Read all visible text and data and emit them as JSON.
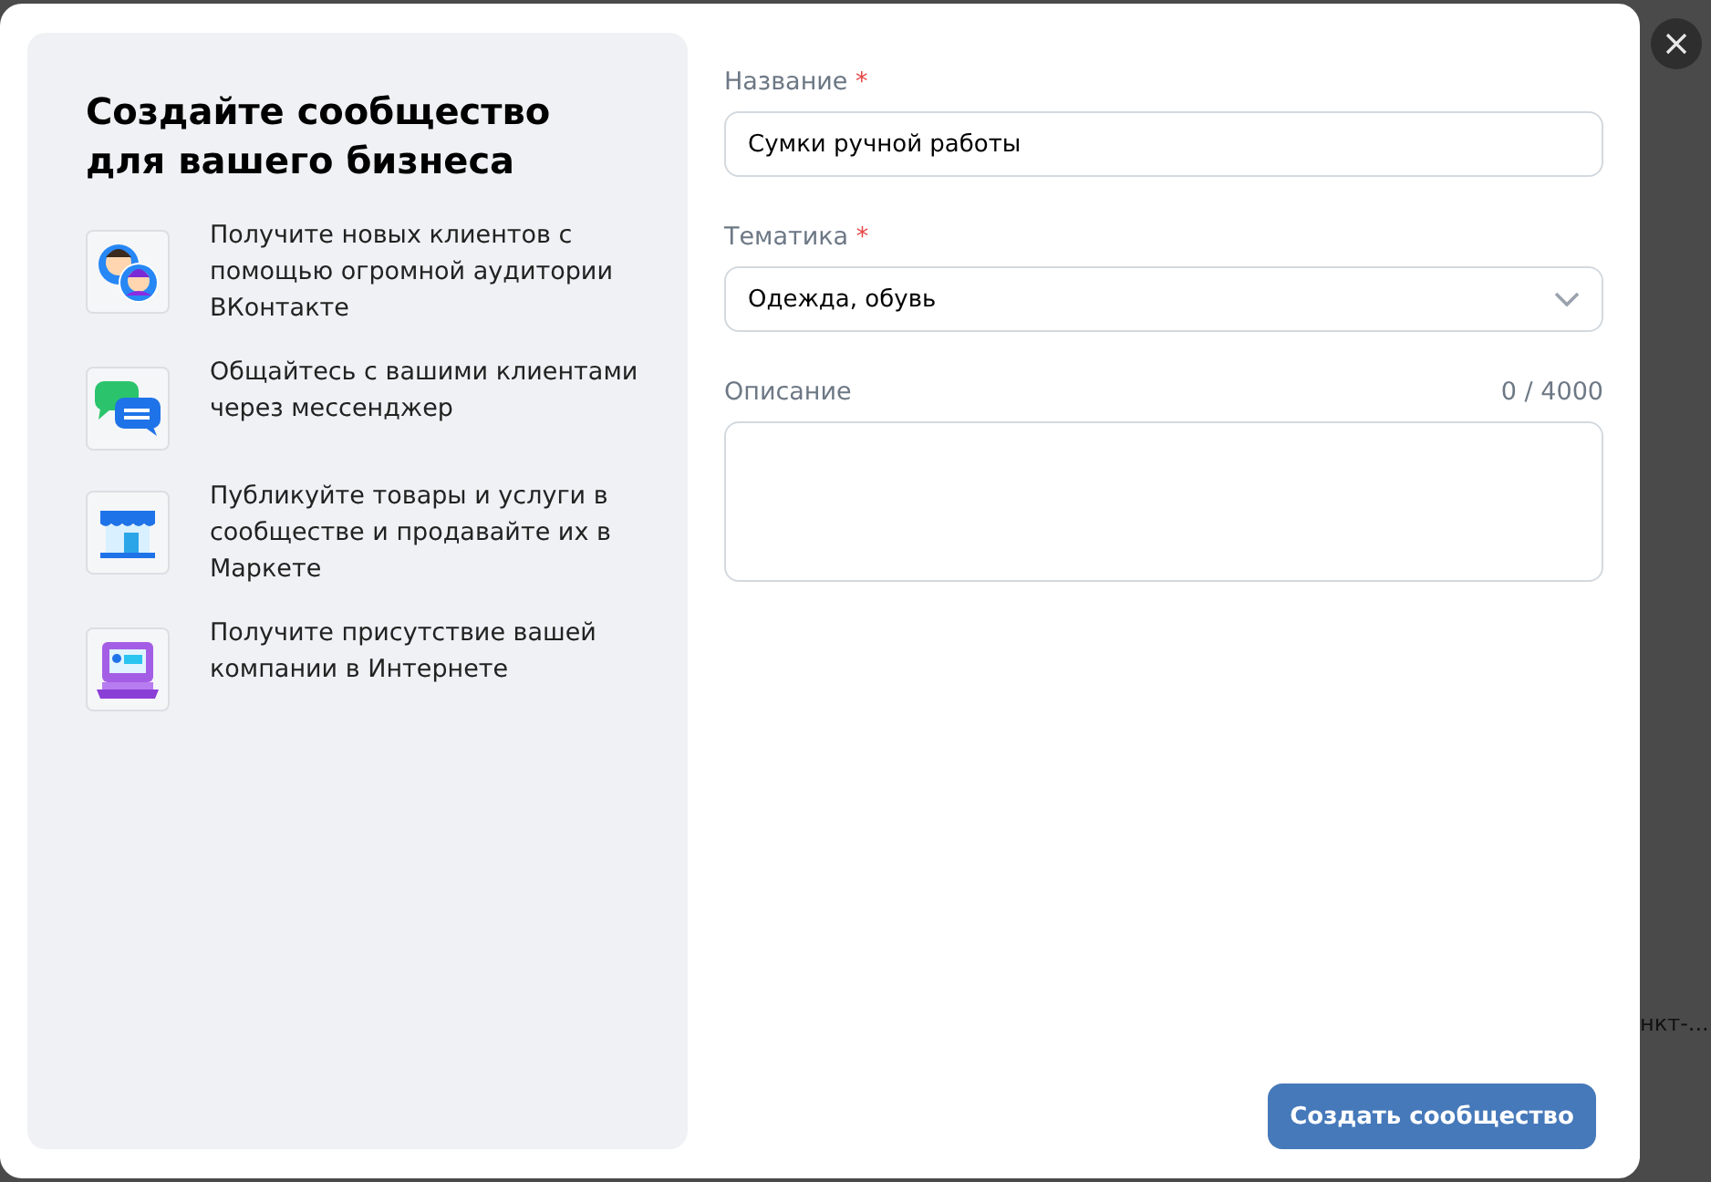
{
  "promo": {
    "title": "Создайте сообщество для вашего бизнеса",
    "features": [
      {
        "text": "Получите новых клиентов с помощью огромной аудитории ВКонтакте"
      },
      {
        "text": "Общайтесь с вашими клиентами через мессенджер"
      },
      {
        "text": "Публикуйте товары и услуги в сообществе и продавайте их в Маркете"
      },
      {
        "text": "Получите присутствие вашей компании в Интернете"
      }
    ]
  },
  "form": {
    "name": {
      "label": "Название",
      "required_mark": "*",
      "value": "Сумки ручной работы"
    },
    "topic": {
      "label": "Тематика",
      "required_mark": "*",
      "value": "Одежда, обувь"
    },
    "description": {
      "label": "Описание",
      "counter": "0 / 4000"
    },
    "submit": "Создать сообщество"
  },
  "background_text": "нкт-..."
}
